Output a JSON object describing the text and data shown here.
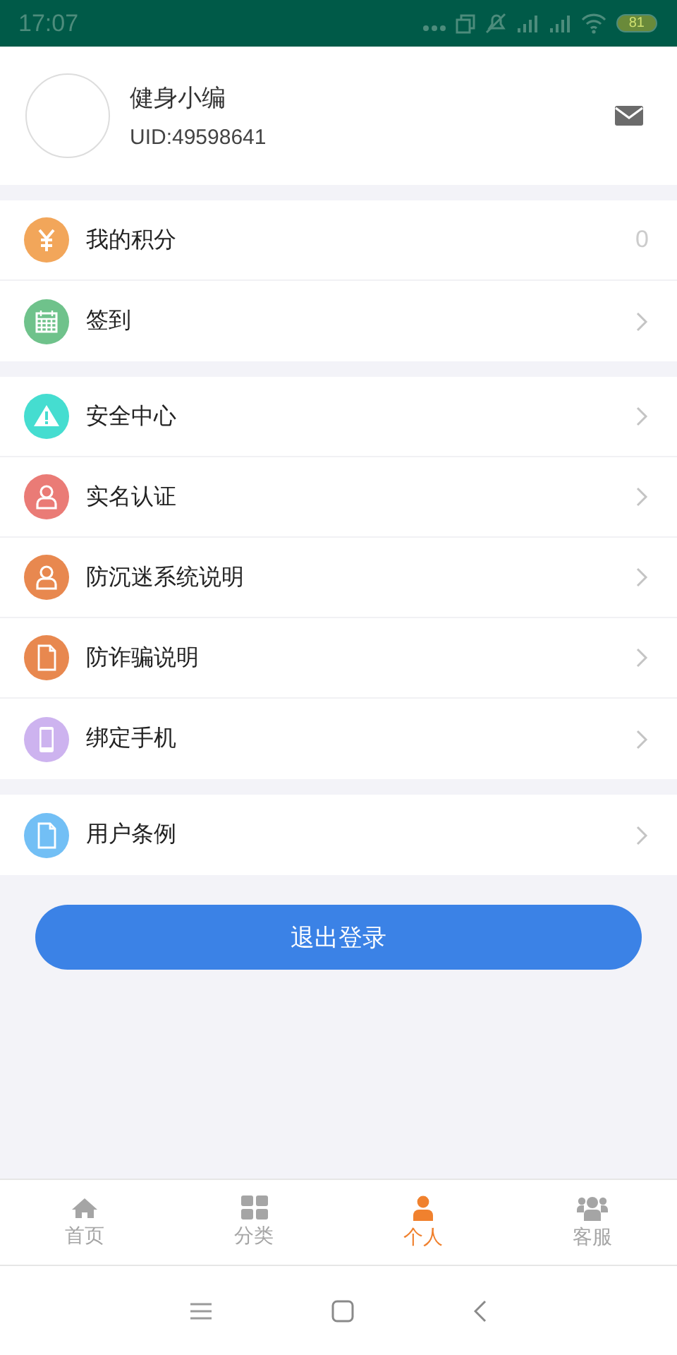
{
  "status_bar": {
    "time": "17:07",
    "battery": "81"
  },
  "profile": {
    "name": "健身小编",
    "uid": "UID:49598641"
  },
  "groups": [
    {
      "items": [
        {
          "label": "我的积分",
          "color": "#f2a65a",
          "value": "0"
        },
        {
          "label": "签到",
          "color": "#6fc28b"
        }
      ]
    },
    {
      "items": [
        {
          "label": "安全中心",
          "color": "#45ddd0"
        },
        {
          "label": "实名认证",
          "color": "#ea7b76"
        },
        {
          "label": "防沉迷系统说明",
          "color": "#e8884f"
        },
        {
          "label": "防诈骗说明",
          "color": "#e8884f"
        },
        {
          "label": "绑定手机",
          "color": "#cdb3ef"
        }
      ]
    },
    {
      "items": [
        {
          "label": "用户条例",
          "color": "#72bff5"
        }
      ]
    }
  ],
  "logout_button": "退出登录",
  "tabs": [
    {
      "label": "首页",
      "selected": false
    },
    {
      "label": "分类",
      "selected": false
    },
    {
      "label": "个人",
      "selected": true
    },
    {
      "label": "客服",
      "selected": false
    }
  ]
}
